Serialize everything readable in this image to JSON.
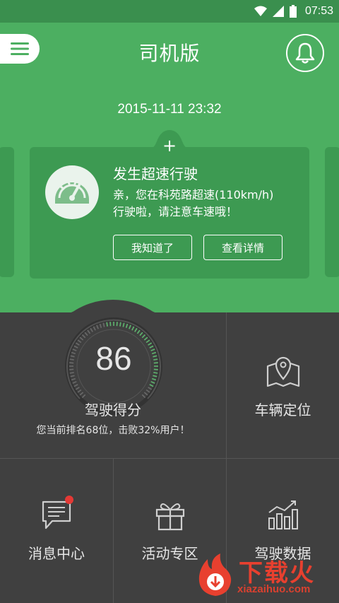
{
  "status_bar": {
    "time": "07:53",
    "icons": [
      "wifi-icon",
      "signal-icon",
      "battery-icon"
    ]
  },
  "header": {
    "title": "司机版",
    "menu_icon": "menu-icon",
    "bell_icon": "bell-icon"
  },
  "alert": {
    "time": "2015-11-11 23:32",
    "title": "发生超速行驶",
    "message_line1": "亲，您在科苑路超速(110km/h)",
    "message_line2": "行驶啦，请注意车速哦！",
    "ok_button": "我知道了",
    "detail_button": "查看详情",
    "icon": "speedometer-icon"
  },
  "score": {
    "value": "86",
    "label": "驾驶得分",
    "sub": "您当前排名68位，击败32%用户！"
  },
  "tiles": {
    "vehicle_location": {
      "label": "车辆定位",
      "icon": "map-location-icon"
    },
    "messages": {
      "label": "消息中心",
      "icon": "message-icon",
      "has_badge": true
    },
    "events": {
      "label": "活动专区",
      "icon": "gift-icon"
    },
    "driving_data": {
      "label": "驾驶数据",
      "icon": "bar-chart-icon"
    }
  },
  "watermark": {
    "title": "下载火",
    "url": "xiazaihuo.com"
  },
  "colors": {
    "primary_green": "#4caf61",
    "card_green": "#3d9a52",
    "status_green": "#3a8f4e",
    "dark_bg": "#404040",
    "text_light": "#e6e6e6",
    "badge_red": "#e53935"
  }
}
